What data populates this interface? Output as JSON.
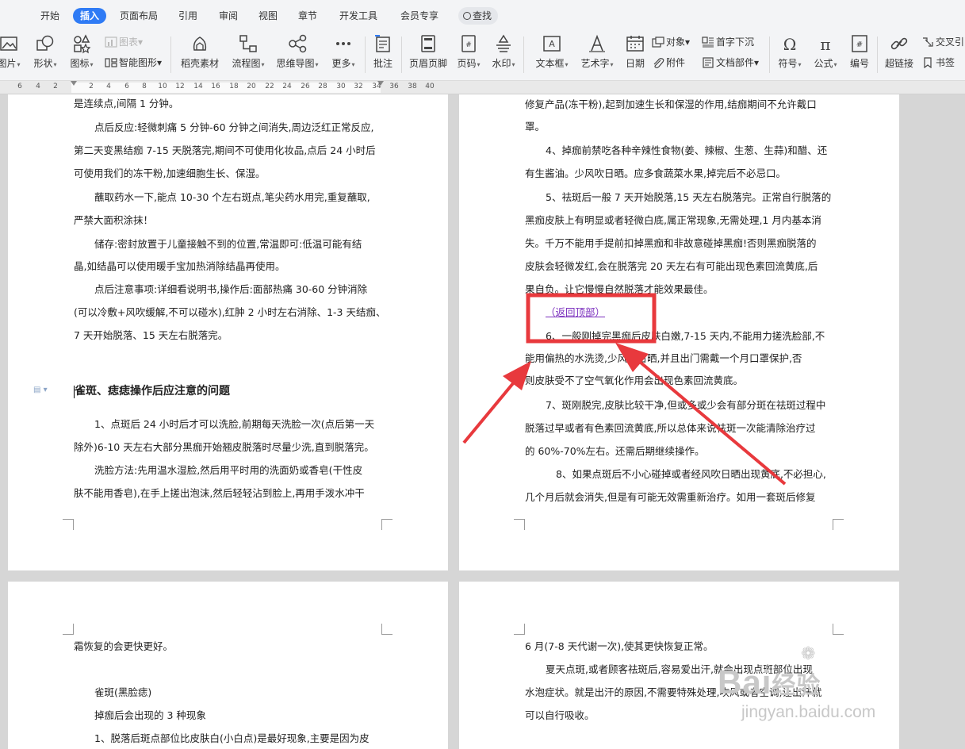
{
  "menu": {
    "tabs": [
      "开始",
      "插入",
      "页面布局",
      "引用",
      "审阅",
      "视图",
      "章节",
      "开发工具",
      "会员专享"
    ],
    "active_tab": "插入",
    "search_label": "查找"
  },
  "toolbar": {
    "picture": "图片",
    "shape": "形状",
    "icon": "图标",
    "chart": "图表",
    "smart_art": "智能图形",
    "stock_material": "稻壳素材",
    "flowchart": "流程图",
    "mindmap": "思维导图",
    "more": "更多",
    "comment": "批注",
    "header_footer": "页眉页脚",
    "page_number": "页码",
    "watermark": "水印",
    "textbox": "文本框",
    "wordart": "艺术字",
    "date": "日期",
    "object": "对象",
    "attachment": "附件",
    "drop_cap": "首字下沉",
    "doc_parts": "文档部件",
    "symbol": "符号",
    "formula": "公式",
    "numbering": "编号",
    "hyperlink": "超链接",
    "cross_ref": "交叉引",
    "bookmark": "书签"
  },
  "ruler": {
    "numbers": [
      "6",
      "4",
      "2",
      "2",
      "4",
      "6",
      "8",
      "10",
      "12",
      "14",
      "16",
      "18",
      "20",
      "22",
      "24",
      "26",
      "28",
      "30",
      "32",
      "34",
      "36",
      "38",
      "40"
    ]
  },
  "page1": {
    "lines": [
      "是连续点,间隔 1 分钟。",
      "点后反应:轻微刺痛 5 分钟-60 分钟之间消失,周边泛红正常反应,",
      "第二天变黑结痂 7-15 天脱落完,期间不可使用化妆品,点后 24 小时后",
      "可使用我们的冻干粉,加速细胞生长、保湿。",
      "蘸取药水一下,能点 10-30 个左右斑点,笔尖药水用完,重复蘸取,",
      "严禁大面积涂抹！",
      "储存:密封放置于儿童接触不到的位置,常温即可:低温可能有结",
      "晶,如结晶可以使用暖手宝加热消除结晶再使用。",
      "点后注意事项:详细看说明书,操作后:面部热痛 30-60 分钟消除",
      "(可以冷敷+风吹缓解,不可以碰水),红肿 2 小时左右消除、1-3 天结痂、",
      "7 天开始脱落、15 天左右脱落完。"
    ],
    "heading": "雀斑、痣痣操作后应注意的问题",
    "lines2": [
      "1、点斑后 24 小时后才可以洗脸,前期每天洗脸一次(点后第一天",
      "除外)6-10 天左右大部分黑痂开始翘皮脱落时尽量少洗,直到脱落完。",
      "洗脸方法:先用温水湿脸,然后用平时用的洗面奶或香皂(干性皮",
      "肤不能用香皂),在手上搓出泡沫,然后轻轻沾到脸上,再用手泼水冲干"
    ]
  },
  "page2": {
    "lines": [
      "修复产品(冻干粉),起到加速生长和保湿的作用,结痂期间不允许戴口",
      "罩。",
      "4、掉痂前禁吃各种辛辣性食物(姜、辣椒、生葱、生蒜)和醋、还",
      "有生酱油。少风吹日晒。应多食蔬菜水果,掉完后不必忌口。",
      "5、祛斑后一般 7 天开始脱落,15 天左右脱落完。正常自行脱落的",
      "黑痂皮肤上有明显或者轻微白底,属正常现象,无需处理,1 月内基本消",
      "失。千万不能用手提前扣掉黑痂和非故意碰掉黑痂!否则黑痂脱落的",
      "皮肤会轻微发红,会在脱落完 20 天左右有可能出现色素回流黄底,后",
      "果自负。让它慢慢自然脱落才能效果最佳。"
    ],
    "back_to_top": "（返回顶部）",
    "lines2": [
      "6、一般刚掉完黑痂后皮肤白嫩,7-15 天内,不能用力搓洗脸部,不",
      "能用偏热的水洗烫,少风吹日晒,并且出门需戴一个月口罩保护,否",
      "则皮肤受不了空气氧化作用会出现色素回流黄底。",
      "7、斑刚脱完,皮肤比较干净,但或多或少会有部分斑在祛斑过程中",
      "脱落过早或者有色素回流黄底,所以总体来说祛斑一次能清除治疗过",
      "的 60%-70%左右。还需后期继续操作。",
      "8、如果点斑后不小心碰掉或者经风吹日晒出现黄底,不必担心,",
      "几个月后就会消失,但是有可能无效需重新治疗。如用一套斑后修复"
    ]
  },
  "page3": {
    "lines": [
      "霜恢复的会更快更好。",
      "雀斑(黑脸痣)",
      "掉痂后会出现的 3 种现象",
      "1、脱落后斑点部位比皮肤白(小白点)是最好现象,主要是因为皮"
    ]
  },
  "page4": {
    "lines": [
      "6 月(7-8 天代谢一次),使其更快恢复正常。",
      "夏天点斑,或者顾客祛斑后,容易爱出汗,就会出现点斑部位出现",
      "水泡症状。就是出汗的原因,不需要特殊处理,吹风或者空调,让出汗就",
      "可以自行吸收。"
    ]
  },
  "watermark": {
    "logo_text": "Bai",
    "logo_cn": "经验",
    "url": "jingyan.baidu.com"
  },
  "colors": {
    "accent": "#2f7bf5",
    "annotation": "#e8393d",
    "link": "#7b2fbe"
  }
}
